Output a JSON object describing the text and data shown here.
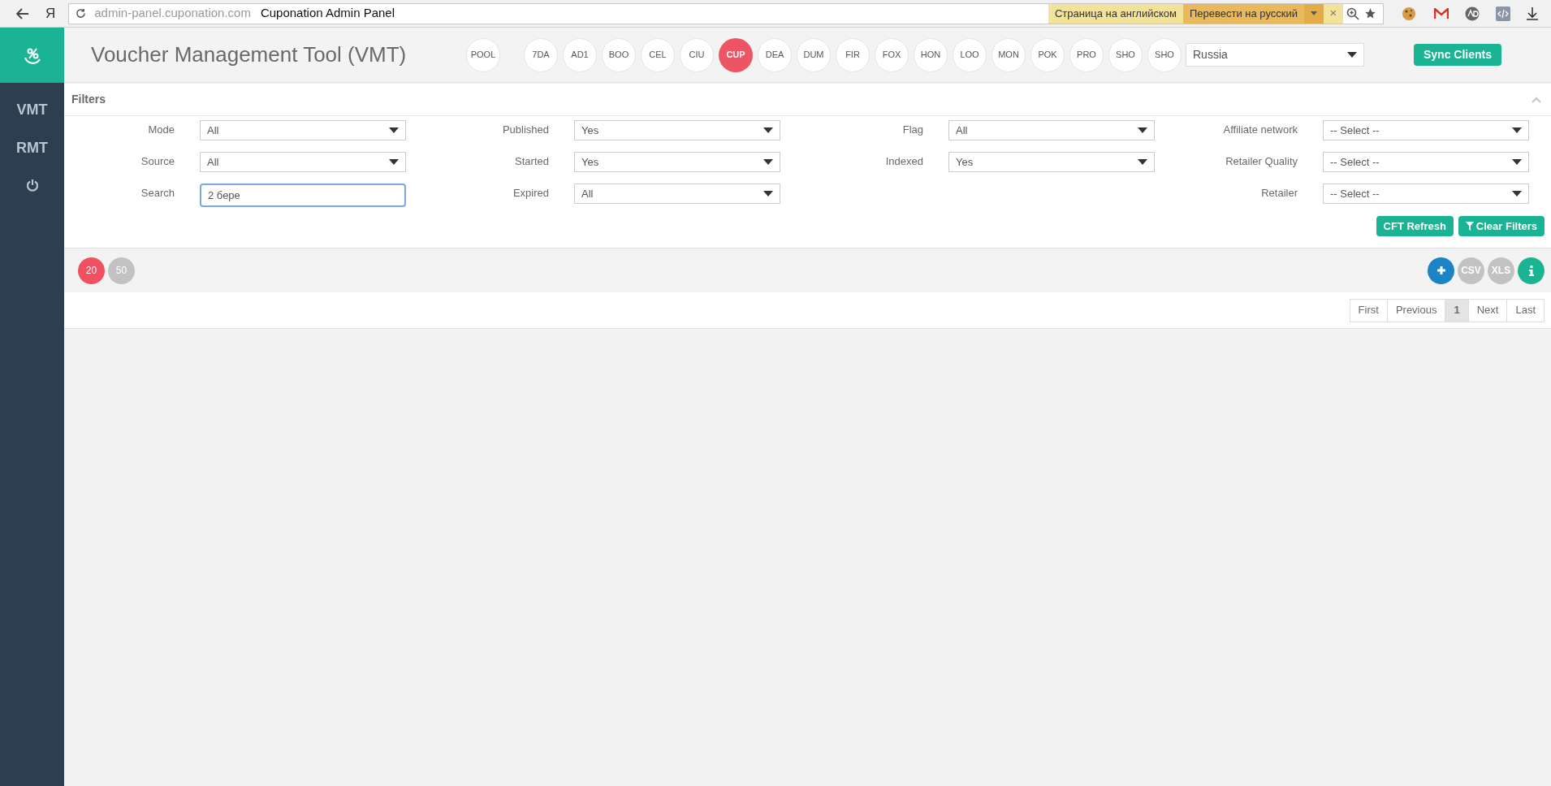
{
  "browser": {
    "logo": "Я",
    "url_host": "admin-panel.cuponation.com",
    "page_title": "Cuponation Admin Panel",
    "translate_notice": "Страница на английском",
    "translate_button": "Перевести на русский",
    "close": "×"
  },
  "sidebar": {
    "items": [
      {
        "kind": "text",
        "label": "VMT"
      },
      {
        "kind": "text",
        "label": "RMT"
      },
      {
        "kind": "power"
      }
    ]
  },
  "header": {
    "title": "Voucher Management Tool (VMT)",
    "pool": "POOL",
    "clients": [
      {
        "label": "7DA",
        "selected": false
      },
      {
        "label": "AD1",
        "selected": false
      },
      {
        "label": "BOO",
        "selected": false
      },
      {
        "label": "CEL",
        "selected": false
      },
      {
        "label": "CIU",
        "selected": false
      },
      {
        "label": "CUP",
        "selected": true
      },
      {
        "label": "DEA",
        "selected": false
      },
      {
        "label": "DUM",
        "selected": false
      },
      {
        "label": "FIR",
        "selected": false
      },
      {
        "label": "FOX",
        "selected": false
      },
      {
        "label": "HON",
        "selected": false
      },
      {
        "label": "LOO",
        "selected": false
      },
      {
        "label": "MON",
        "selected": false
      },
      {
        "label": "POK",
        "selected": false
      },
      {
        "label": "PRO",
        "selected": false
      },
      {
        "label": "SHO",
        "selected": false
      },
      {
        "label": "SHO",
        "selected": false
      }
    ],
    "country": "Russia",
    "sync_button": "Sync Clients"
  },
  "filters": {
    "title": "Filters",
    "columns": [
      [
        {
          "label": "Mode",
          "kind": "select",
          "value": "All"
        },
        {
          "label": "Source",
          "kind": "select",
          "value": "All"
        },
        {
          "label": "Search",
          "kind": "text",
          "value": "2 бере"
        }
      ],
      [
        {
          "label": "Published",
          "kind": "select",
          "value": "Yes"
        },
        {
          "label": "Started",
          "kind": "select",
          "value": "Yes"
        },
        {
          "label": "Expired",
          "kind": "select",
          "value": "All"
        }
      ],
      [
        {
          "label": "Flag",
          "kind": "select",
          "value": "All"
        },
        {
          "label": "Indexed",
          "kind": "select",
          "value": "Yes"
        }
      ],
      [
        {
          "label": "Affiliate network",
          "kind": "select",
          "value": "-- Select --"
        },
        {
          "label": "Retailer Quality",
          "kind": "select",
          "value": "-- Select --"
        },
        {
          "label": "Retailer",
          "kind": "select",
          "value": "-- Select --"
        }
      ]
    ],
    "buttons": [
      "CFT Refresh",
      "Clear Filters"
    ]
  },
  "toolbar": {
    "page_sizes": [
      {
        "label": "20",
        "selected": true
      },
      {
        "label": "50",
        "selected": false
      }
    ],
    "exports": [
      "CSV",
      "XLS"
    ]
  },
  "pagination": [
    {
      "label": "First",
      "selected": false
    },
    {
      "label": "Previous",
      "selected": false
    },
    {
      "label": "1",
      "selected": true
    },
    {
      "label": "Next",
      "selected": false
    },
    {
      "label": "Last",
      "selected": false
    }
  ]
}
